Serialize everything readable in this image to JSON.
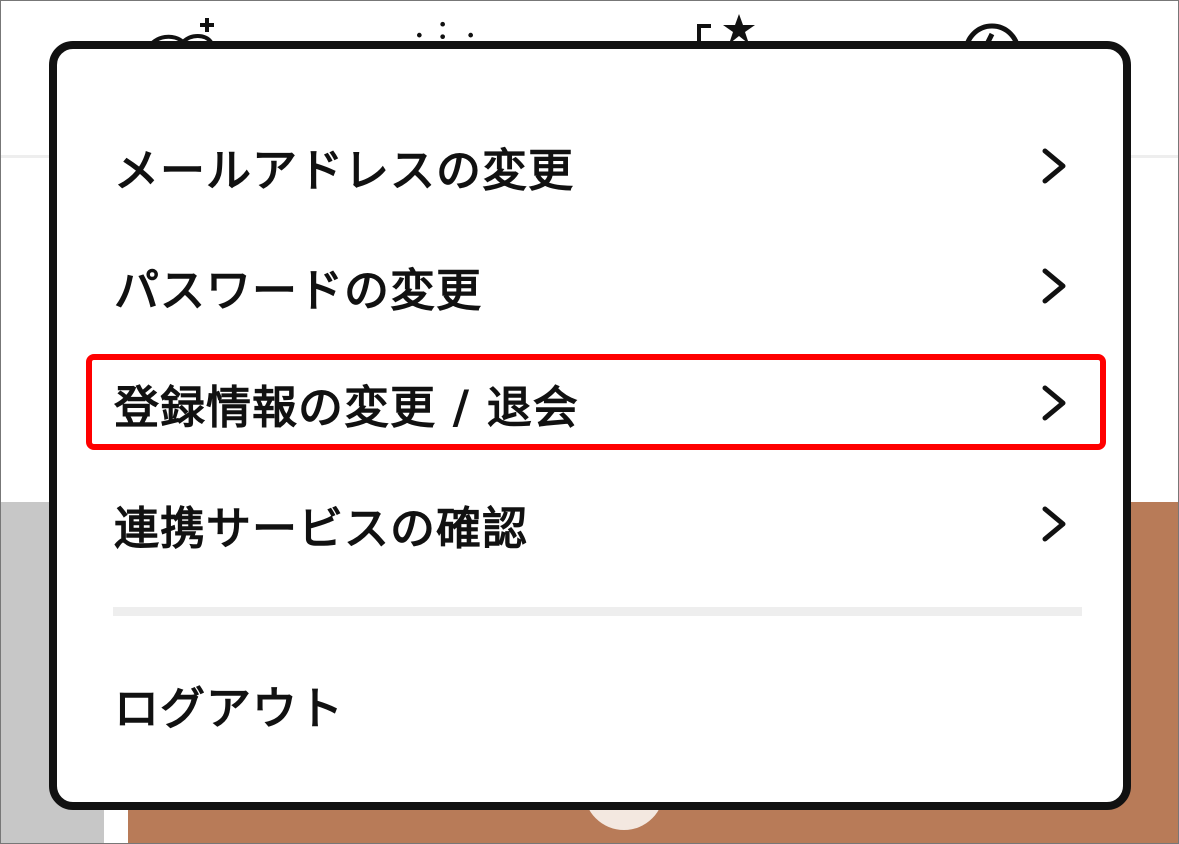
{
  "menu": {
    "items": [
      {
        "label": "メールアドレスの変更",
        "chevron": "chevron-right-icon"
      },
      {
        "label": "パスワードの変更",
        "chevron": "chevron-right-icon"
      },
      {
        "label": "登録情報の変更 / 退会",
        "chevron": "chevron-right-icon",
        "highlighted": true
      },
      {
        "label": "連携サービスの確認",
        "chevron": "chevron-right-icon"
      }
    ],
    "logout_label": "ログアウト"
  },
  "colors": {
    "highlight_border": "#ff0000",
    "modal_border": "#111111",
    "background_brown": "#b87b58",
    "background_gray": "#c7c7c7"
  }
}
